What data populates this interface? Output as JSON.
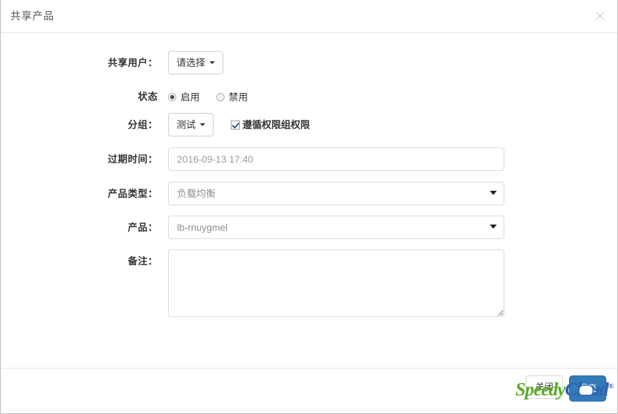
{
  "modal": {
    "title": "共享产品",
    "close_icon": "×"
  },
  "form": {
    "rows": [
      {
        "label": "共享用户：",
        "type": "dropdown",
        "value": "请选择"
      },
      {
        "label": "状态",
        "type": "radio"
      },
      {
        "label": "分组：",
        "type": "dropdown-check",
        "value": "测试",
        "checkbox_label": "遵循权限组权限",
        "checked": true
      },
      {
        "label": "过期时间：",
        "type": "text",
        "value": "2016-09-13 17:40",
        "placeholder": "2016-09-13 17:40"
      },
      {
        "label": "产品类型：",
        "type": "select",
        "value": "负载均衡"
      },
      {
        "label": "产品：",
        "type": "select",
        "value": "lb-rnuygmel"
      },
      {
        "label": "备注：",
        "type": "textarea",
        "value": "",
        "placeholder": ""
      }
    ],
    "status": {
      "options": [
        {
          "label": "启用",
          "selected": true
        },
        {
          "label": "禁用",
          "selected": false
        }
      ]
    }
  },
  "footer": {
    "close_label": "关闭",
    "submit_label": "提交"
  },
  "watermark": {
    "part1": "Speedy",
    "part2": "Cloud",
    "registered": "®"
  },
  "colors": {
    "primary": "#337ab7",
    "watermark_green": "#5aaa28",
    "watermark_blue": "#2f5fb0",
    "border": "#d8d8d8"
  }
}
